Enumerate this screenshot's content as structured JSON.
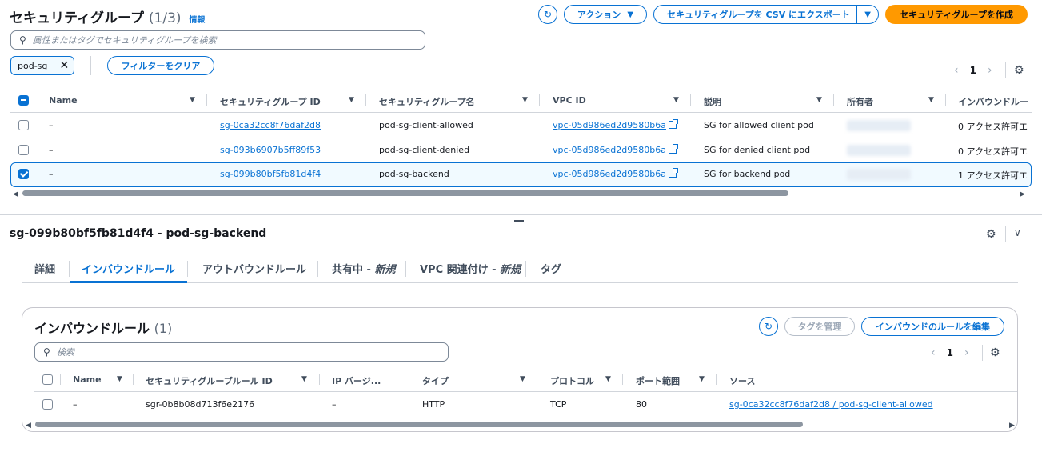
{
  "header": {
    "title": "セキュリティグループ",
    "count": "(1/3)",
    "info": "情報",
    "actions_label": "アクション",
    "export_label": "セキュリティグループを CSV にエクスポート",
    "create_label": "セキュリティグループを作成"
  },
  "search": {
    "placeholder": "属性またはタグでセキュリティグループを検索"
  },
  "filter": {
    "token": "pod-sg",
    "clear_label": "フィルターをクリア"
  },
  "pagination": {
    "page": "1"
  },
  "sg_table": {
    "columns": [
      "Name",
      "セキュリティグループ ID",
      "セキュリティグループ名",
      "VPC ID",
      "説明",
      "所有者",
      "インバウンドルー"
    ],
    "rows": [
      {
        "name": "–",
        "id": "sg-0ca32cc8f76daf2d8",
        "sg_name": "pod-sg-client-allowed",
        "vpc": "vpc-05d986ed2d9580b6a",
        "desc": "SG for allowed client pod",
        "inbound": "0 アクセス許可エ",
        "selected": false
      },
      {
        "name": "–",
        "id": "sg-093b6907b5ff89f53",
        "sg_name": "pod-sg-client-denied",
        "vpc": "vpc-05d986ed2d9580b6a",
        "desc": "SG for denied client pod",
        "inbound": "0 アクセス許可エ",
        "selected": false
      },
      {
        "name": "–",
        "id": "sg-099b80bf5fb81d4f4",
        "sg_name": "pod-sg-backend",
        "vpc": "vpc-05d986ed2d9580b6a",
        "desc": "SG for backend pod",
        "inbound": "1 アクセス許可エ",
        "selected": true
      }
    ]
  },
  "detail": {
    "title": "sg-099b80bf5fb81d4f4 - pod-sg-backend",
    "tabs": [
      {
        "label": "詳細"
      },
      {
        "label": "インバウンドルール"
      },
      {
        "label": "アウトバウンドルール"
      },
      {
        "label": "共有中 - ",
        "badge": "新規"
      },
      {
        "label": "VPC 関連付け - ",
        "badge": "新規"
      },
      {
        "label": "タグ"
      }
    ]
  },
  "inbound": {
    "title": "インバウンドルール",
    "count": "(1)",
    "manage_tags_label": "タグを管理",
    "edit_label": "インバウンドのルールを編集",
    "search_placeholder": "検索",
    "page": "1",
    "columns": [
      "Name",
      "セキュリティグループルール ID",
      "IP バージ...",
      "タイプ",
      "プロトコル",
      "ポート範囲",
      "ソース"
    ],
    "rows": [
      {
        "name": "–",
        "rule_id": "sgr-0b8b08d713f6e2176",
        "ip_version": "–",
        "type": "HTTP",
        "protocol": "TCP",
        "port": "80",
        "source": "sg-0ca32cc8f76daf2d8 / pod-sg-client-allowed"
      }
    ]
  },
  "colors": {
    "accent": "#0972d3",
    "primary": "#ff9900",
    "selected_bg": "#f1faff"
  }
}
